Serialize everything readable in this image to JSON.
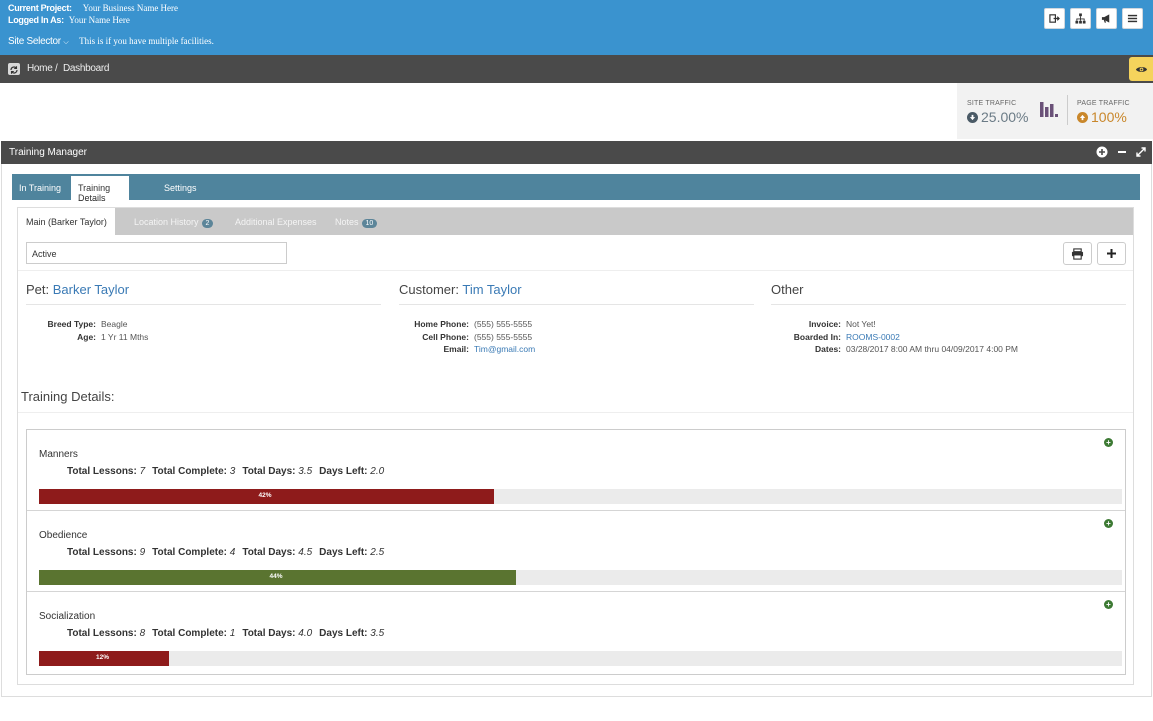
{
  "header": {
    "current_project_label": "Current Project:",
    "current_project_value": "Your Business Name Here",
    "logged_in_label": "Logged In As:",
    "logged_in_value": "Your Name Here",
    "site_selector_label": "Site Selector",
    "site_selector_note": "This is if you have multiple facilities.",
    "icons": [
      "logout-icon",
      "sitemap-icon",
      "megaphone-icon",
      "menu-icon"
    ]
  },
  "breadcrumb": {
    "home": "Home",
    "separator": "/",
    "current": "Dashboard"
  },
  "traffic": {
    "site_label": "SITE TRAFFIC",
    "site_value": "25.00%",
    "page_label": "PAGE TRAFFIC",
    "page_value": "100%",
    "down_color": "#4a5a66",
    "up_color": "#c9872b"
  },
  "panel": {
    "title": "Training Manager",
    "tabs": [
      {
        "label": "In Training",
        "active": false
      },
      {
        "label": "Training Details",
        "active": true
      },
      {
        "label": "Settings",
        "active": false
      }
    ]
  },
  "subtabs": {
    "main": "Main (Barker Taylor)",
    "location_history": "Location History",
    "location_history_count": "2",
    "additional_expenses": "Additional Expenses",
    "notes": "Notes",
    "notes_count": "10"
  },
  "status_value": "Active",
  "pet": {
    "section_label": "Pet:",
    "name": "Barker Taylor",
    "breed_label": "Breed Type:",
    "breed": "Beagle",
    "age_label": "Age:",
    "age": "1 Yr 11 Mths"
  },
  "customer": {
    "section_label": "Customer:",
    "name": "Tim Taylor",
    "home_label": "Home Phone:",
    "home": "(555) 555-5555",
    "cell_label": "Cell Phone:",
    "cell": "(555) 555-5555",
    "email_label": "Email:",
    "email": "Tim@gmail.com"
  },
  "other": {
    "section_label": "Other",
    "invoice_label": "Invoice:",
    "invoice": "Not Yet!",
    "boarded_label": "Boarded In:",
    "boarded": "ROOMS-0002",
    "dates_label": "Dates:",
    "dates": "03/28/2017 8:00 AM thru 04/09/2017 4:00 PM"
  },
  "training_details_title": "Training Details:",
  "stat_labels": {
    "total_lessons": "Total Lessons:",
    "total_complete": "Total Complete:",
    "total_days": "Total Days:",
    "days_left": "Days Left:"
  },
  "courses": [
    {
      "name": "Manners",
      "total_lessons": "7",
      "total_complete": "3",
      "total_days": "3.5",
      "days_left": "2.0",
      "progress": 42,
      "progress_label": "42%",
      "color": "#8e1b1b"
    },
    {
      "name": "Obedience",
      "total_lessons": "9",
      "total_complete": "4",
      "total_days": "4.5",
      "days_left": "2.5",
      "progress": 44,
      "progress_label": "44%",
      "color": "#5a7430"
    },
    {
      "name": "Socialization",
      "total_lessons": "8",
      "total_complete": "1",
      "total_days": "4.0",
      "days_left": "3.5",
      "progress": 12,
      "progress_label": "12%",
      "color": "#8e1b1b"
    }
  ]
}
